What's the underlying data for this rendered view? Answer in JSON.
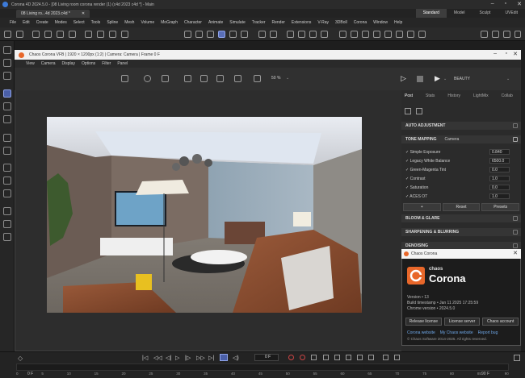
{
  "window": {
    "title": "Corona 4D 2024.5.0 - [08 Living room corona render (1) (c4d 2023 c4d *] - Main",
    "doc_tab": "08 Living ro...4d 2023.c4d *",
    "layouts": [
      "Standard",
      "Model",
      "Sculpt",
      "UVEdit"
    ],
    "active_layout": "Standard"
  },
  "menubar": [
    "File",
    "Edit",
    "Create",
    "Modes",
    "Select",
    "Tools",
    "Spline",
    "Mesh",
    "Volume",
    "MoGraph",
    "Character",
    "Animate",
    "Simulate",
    "Tracker",
    "Render",
    "Extensions",
    "V-Ray",
    "3DBoll",
    "Corona",
    "Window",
    "Help"
  ],
  "vfb": {
    "title": "Chaos Corona VFB | 1920 × 1200px (1:2) | Camera: Camera | Frame 0 F",
    "menu": [
      "View",
      "Camera",
      "Display",
      "Options",
      "Filter",
      "Panel"
    ],
    "zoom": "50 %",
    "beauty": "BEAUTY",
    "tabs": [
      "Post",
      "Stats",
      "History",
      "LightMix",
      "Collab"
    ],
    "active_tab": "Post",
    "sections": {
      "auto_adjustment": "AUTO ADJUSTMENT",
      "tone_mapping": "TONE MAPPING",
      "camera_label": "Camera",
      "bloom_glare": "BLOOM & GLARE",
      "sharpening": "SHARPENING & BLURRING",
      "denoising": "DENOISING"
    },
    "tone_rows": [
      {
        "label": "✓ Simple Exposure",
        "value": "0.840"
      },
      {
        "label": "✓ Legacy White Balance",
        "value": "6500.0"
      },
      {
        "label": "✓ Green-Magenta Tint",
        "value": "0.0"
      },
      {
        "label": "✓ Contrast",
        "value": "1.0"
      },
      {
        "label": "✓ Saturation",
        "value": "0.0"
      },
      {
        "label": "✓ ACES OT",
        "value": "1.0"
      }
    ],
    "buttons": [
      "+",
      "Reset",
      "Presets"
    ]
  },
  "splash": {
    "title": "Chaos Corona",
    "brand_small": "chaos",
    "brand": "Corona",
    "version": "Version • 13",
    "build": "Build timestamp • Jan 11 2025 17:25:59",
    "chrome": "Chrome version • 2024.5.0",
    "buttons": [
      "Release license",
      "License server",
      "Chaos account"
    ],
    "links": [
      "Corona website",
      "My Chaos website",
      "Report bug"
    ],
    "copyright": "© Chaos Software 2014-2025. All rights reserved."
  },
  "timeline": {
    "frame": "0 F",
    "ticks": [
      "0",
      "5",
      "10",
      "15",
      "20",
      "25",
      "30",
      "35",
      "40",
      "45",
      "50",
      "55",
      "60",
      "65",
      "70",
      "75",
      "80",
      "85",
      "90"
    ],
    "start": "0 F",
    "end": "90 F"
  },
  "colors": {
    "accent": "#5a6fb8",
    "corona_orange": "#e8672a"
  }
}
